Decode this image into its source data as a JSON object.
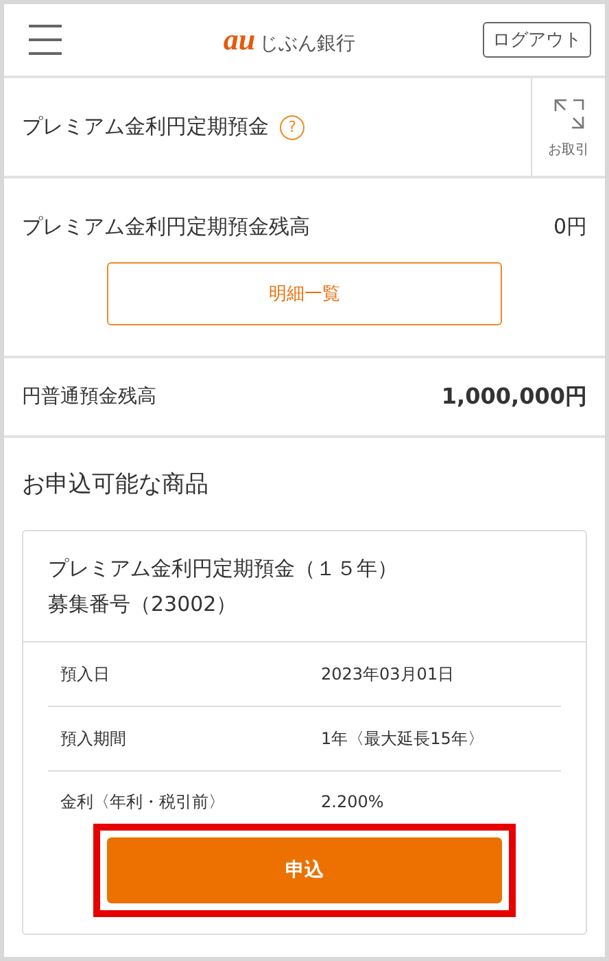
{
  "header": {
    "logo_mark": "au",
    "logo_text": "じぶん銀行",
    "logout": "ログアウト"
  },
  "product_bar": {
    "title": "プレミアム金利円定期預金",
    "help": "?",
    "transfer_label": "お取引"
  },
  "balance": {
    "label": "プレミアム金利円定期預金残高",
    "amount": "0円",
    "details_button": "明細一覧"
  },
  "savings": {
    "label": "円普通預金残高",
    "amount": "1,000,000円"
  },
  "offers": {
    "heading": "お申込可能な商品",
    "card": {
      "title": "プレミアム金利円定期預金（１５年）",
      "number": "募集番号（23002）",
      "rows": [
        {
          "label": "預入日",
          "value": "2023年03月01日"
        },
        {
          "label": "預入期間",
          "value": "1年〈最大延長15年〉"
        },
        {
          "label": "金利〈年利・税引前〉",
          "value": "2.200%"
        }
      ],
      "apply_button": "申込",
      "apply_highlighted": true
    }
  }
}
